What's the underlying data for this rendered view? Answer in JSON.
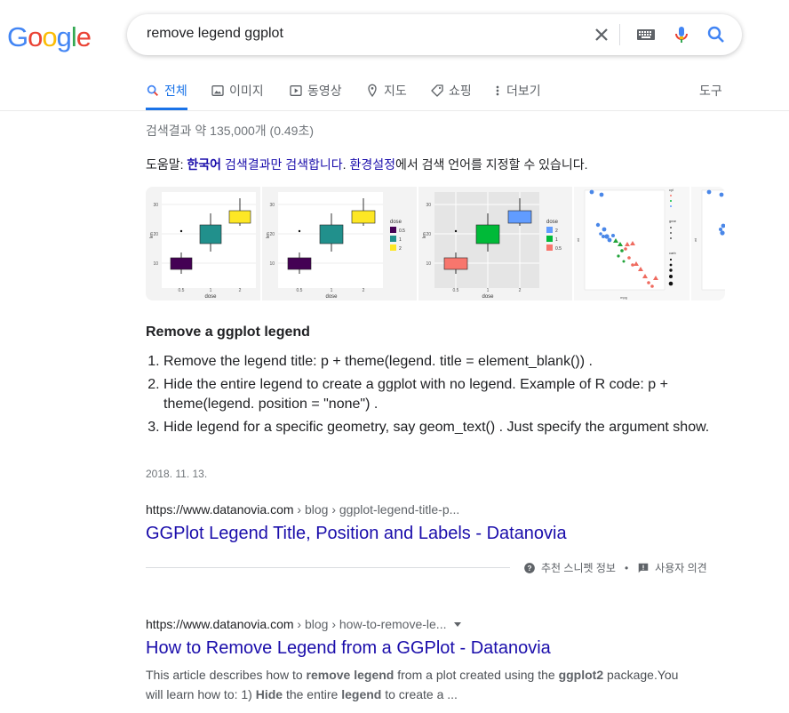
{
  "logo": {
    "text": "Google",
    "letters": [
      "G",
      "o",
      "o",
      "g",
      "l",
      "e"
    ],
    "colors": [
      "#4285f4",
      "#ea4335",
      "#fbbc05",
      "#4285f4",
      "#34a853",
      "#ea4335"
    ]
  },
  "search": {
    "query": "remove legend ggplot"
  },
  "icons": {
    "clear": "close-icon",
    "keyboard": "keyboard-icon",
    "mic": "mic-icon",
    "search": "search-icon"
  },
  "tabs": [
    {
      "label": "전체",
      "icon": "search-icon",
      "active": true
    },
    {
      "label": "이미지",
      "icon": "image-icon"
    },
    {
      "label": "동영상",
      "icon": "video-icon"
    },
    {
      "label": "지도",
      "icon": "map-pin-icon"
    },
    {
      "label": "쇼핑",
      "icon": "tag-icon"
    },
    {
      "label": "더보기",
      "icon": "more-vert-icon"
    }
  ],
  "tools_label": "도구",
  "stats": "검색결과 약 135,000개 (0.49초)",
  "language_hint": {
    "prefix": "도움말: ",
    "lang_link": "한국어",
    "mid_link": " 검색결과만 검색합니다",
    "dot": ". ",
    "settings_link": "환경설정",
    "suffix": "에서 검색 언어를 지정할 수 있습니다."
  },
  "images": {
    "axis_labels": {
      "x": "dose",
      "y": "len"
    },
    "legend_title": "dose",
    "legend_values": [
      "0.5",
      "1",
      "2"
    ],
    "x_ticks": [
      "0.5",
      "1",
      "2"
    ],
    "y_ticks": [
      "10",
      "20",
      "30"
    ],
    "palette1": [
      "#440154",
      "#21908c",
      "#fde725"
    ],
    "palette3": [
      "#f8766d",
      "#00ba38",
      "#619cff"
    ],
    "scatter_xlabel": "mpg",
    "scatter_ylabel": "wt",
    "scatter_legend": [
      "cyl",
      "gear",
      "carb"
    ]
  },
  "snippet": {
    "title": "Remove a ggplot legend",
    "items": [
      "Remove the legend title: p + theme(legend. title = element_blank()) .",
      "Hide the entire legend to create a ggplot with no legend. Example of R code: p + theme(legend. position = \"none\") .",
      "Hide legend for a specific geometry, say geom_text() . Just specify the argument show."
    ],
    "date": "2018. 11. 13.",
    "cite_domain": "https://www.datanovia.com",
    "cite_path": " › blog › ggplot-legend-title-p...",
    "result_title": "GGPlot Legend Title, Position and Labels - Datanovia",
    "about_label": "추천 스니펫 정보",
    "feedback_label": "사용자 의견",
    "bullet": "•"
  },
  "result2": {
    "cite_domain": "https://www.datanovia.com",
    "cite_path": " › blog › how-to-remove-le...",
    "title": "How to Remove Legend from a GGPlot - Datanovia",
    "desc_parts": [
      "This article describes how to ",
      "remove legend",
      " from a plot created using the ",
      "ggplot2",
      " package.You will learn how to: 1) ",
      "Hide",
      " the entire ",
      "legend",
      " to create a ..."
    ]
  },
  "colors": {
    "accent": "#1a73e8",
    "link": "#1a0dab",
    "muted": "#70757a"
  }
}
